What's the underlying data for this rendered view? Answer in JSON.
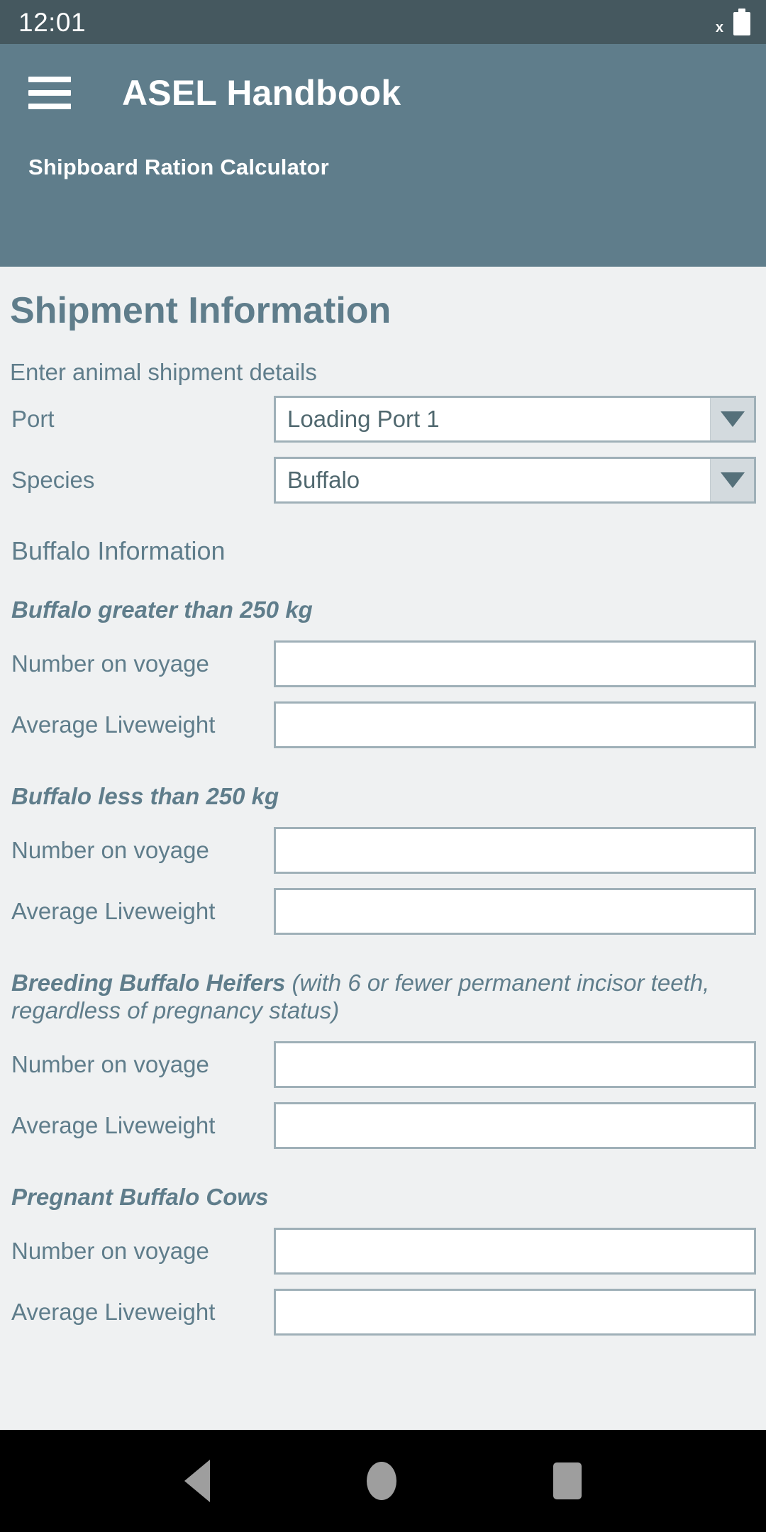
{
  "status_bar": {
    "time": "12:01",
    "close_glyph": "x",
    "battery_icon": "battery-full-icon"
  },
  "app_bar": {
    "menu_icon": "hamburger-menu-icon",
    "title": "ASEL Handbook",
    "subtitle": "Shipboard Ration Calculator",
    "background_color": "#5f7d8b"
  },
  "page": {
    "title": "Shipment Information",
    "description": "Enter animal shipment details",
    "accent_color": "#5f7d8b",
    "background_color": "#eff1f2"
  },
  "shipment": {
    "port": {
      "label": "Port",
      "value": "Loading Port 1",
      "arrow_icon": "chevron-down-icon"
    },
    "species": {
      "label": "Species",
      "value": "Buffalo",
      "arrow_icon": "chevron-down-icon"
    }
  },
  "species_section": {
    "heading": "Buffalo Information",
    "groups": [
      {
        "title": "Buffalo greater than 250 kg",
        "note": "",
        "fields": [
          {
            "label": "Number on voyage",
            "value": "",
            "placeholder": ""
          },
          {
            "label": "Average Liveweight",
            "value": "",
            "placeholder": ""
          }
        ]
      },
      {
        "title": "Buffalo less than 250 kg",
        "note": "",
        "fields": [
          {
            "label": "Number on voyage",
            "value": "",
            "placeholder": ""
          },
          {
            "label": "Average Liveweight",
            "value": "",
            "placeholder": ""
          }
        ]
      },
      {
        "title": "Breeding Buffalo Heifers",
        "note": " (with 6 or fewer permanent incisor teeth, regardless of pregnancy status)",
        "fields": [
          {
            "label": "Number on voyage",
            "value": "",
            "placeholder": ""
          },
          {
            "label": "Average Liveweight",
            "value": "",
            "placeholder": ""
          }
        ]
      },
      {
        "title": "Pregnant Buffalo Cows",
        "note": "",
        "fields": [
          {
            "label": "Number on voyage",
            "value": "",
            "placeholder": ""
          },
          {
            "label": "Average Liveweight",
            "value": "",
            "placeholder": ""
          }
        ]
      }
    ]
  },
  "nav_bar": {
    "back_icon": "back-triangle-icon",
    "home_icon": "home-circle-icon",
    "recents_icon": "recents-square-icon"
  }
}
